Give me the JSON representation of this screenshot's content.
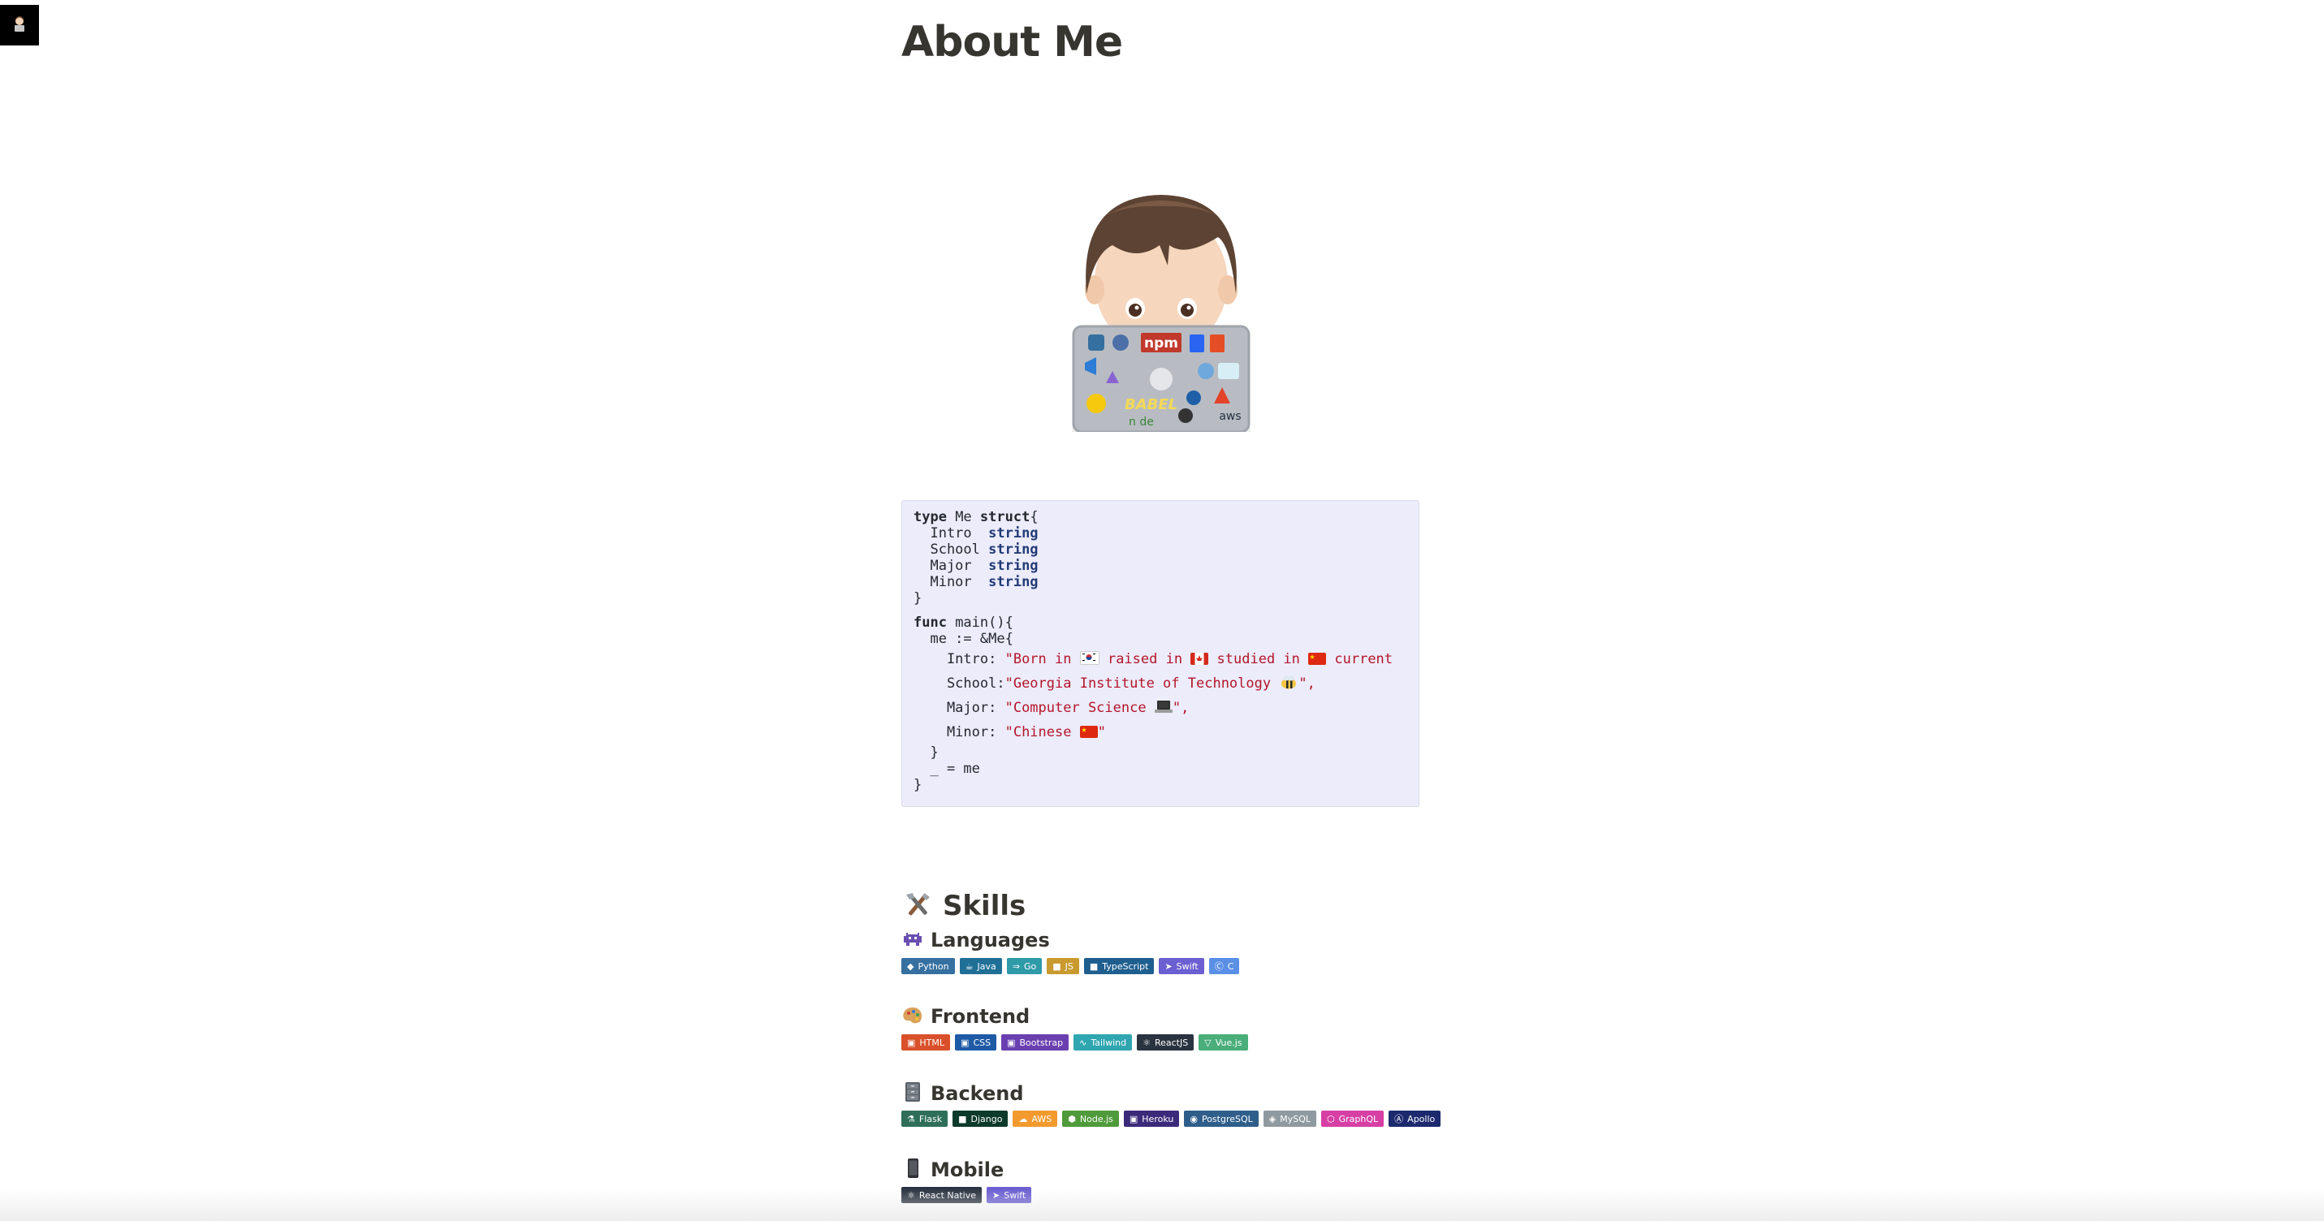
{
  "corner": {
    "icon": "avatar-icon"
  },
  "page": {
    "title": "About Me"
  },
  "avatar": {
    "icon": "memoji-laptop-icon"
  },
  "code": {
    "line1_kw1": "type",
    "line1_name": " Me ",
    "line1_kw2": "struct",
    "line1_end": "{",
    "fields": [
      {
        "name": "  Intro  ",
        "type": "string"
      },
      {
        "name": "  School ",
        "type": "string"
      },
      {
        "name": "  Major  ",
        "type": "string"
      },
      {
        "name": "  Minor  ",
        "type": "string"
      }
    ],
    "close1": "}",
    "func_kw": "func",
    "func_rest": " main(){",
    "me_line": "  me := &Me{",
    "intro_key": "    Intro: ",
    "intro_str_a": "\"Born in ",
    "intro_str_b": " raised in ",
    "intro_str_c": " studied in ",
    "intro_str_d": " current",
    "school_key": "    School:",
    "school_str": "\"Georgia Institute of Technology ",
    "school_end": "\",",
    "major_key": "    Major: ",
    "major_str": "\"Computer Science ",
    "major_end": "\",",
    "minor_key": "    Minor: ",
    "minor_str": "\"Chinese ",
    "minor_end": "\"",
    "close2": "  }",
    "assign": "  _ = me",
    "close3": "}",
    "flag_colors": {
      "korea": "#ffffff",
      "canada": "#d52b1e",
      "china": "#de2910"
    }
  },
  "skills": {
    "heading": "Skills",
    "heading_icon": "tools-icon",
    "sections": [
      {
        "title": "Languages",
        "icon": "alien-monster-icon",
        "badges": [
          {
            "label": "Python",
            "color": "#3670a0",
            "icon": "python-icon"
          },
          {
            "label": "Java",
            "color": "#1f6f97",
            "icon": "java-icon"
          },
          {
            "label": "Go",
            "color": "#2f9aa8",
            "icon": "go-icon"
          },
          {
            "label": "JS",
            "color": "#c99a2e",
            "icon": "javascript-icon"
          },
          {
            "label": "TypeScript",
            "color": "#1f5f8f",
            "icon": "typescript-icon"
          },
          {
            "label": "Swift",
            "color": "#6b5fd1",
            "icon": "swift-icon"
          },
          {
            "label": "C",
            "color": "#5a8fe6",
            "icon": "c-icon"
          }
        ]
      },
      {
        "title": "Frontend",
        "icon": "palette-icon",
        "badges": [
          {
            "label": "HTML",
            "color": "#d9502b",
            "icon": "html5-icon"
          },
          {
            "label": "CSS",
            "color": "#1f5aa6",
            "icon": "css3-icon"
          },
          {
            "label": "Bootstrap",
            "color": "#6a3fb0",
            "icon": "bootstrap-icon"
          },
          {
            "label": "Tailwind",
            "color": "#2fa6b0",
            "icon": "tailwind-icon"
          },
          {
            "label": "ReactJS",
            "color": "#2a3340",
            "icon": "react-icon"
          },
          {
            "label": "Vue.js",
            "color": "#4aae7a",
            "icon": "vue-icon"
          }
        ]
      },
      {
        "title": "Backend",
        "icon": "file-cabinet-icon",
        "badges": [
          {
            "label": "Flask",
            "color": "#2f6f5a",
            "icon": "flask-icon"
          },
          {
            "label": "Django",
            "color": "#0c3a2b",
            "icon": "django-icon"
          },
          {
            "label": "AWS",
            "color": "#f29a2e",
            "icon": "aws-icon"
          },
          {
            "label": "Node.js",
            "color": "#4f9a3a",
            "icon": "node-icon"
          },
          {
            "label": "Heroku",
            "color": "#3b2a7a",
            "icon": "heroku-icon"
          },
          {
            "label": "PostgreSQL",
            "color": "#2f5e8a",
            "icon": "postgresql-icon"
          },
          {
            "label": "MySQL",
            "color": "#8f9aa0",
            "icon": "mysql-icon"
          },
          {
            "label": "GraphQL",
            "color": "#d63fa4",
            "icon": "graphql-icon"
          },
          {
            "label": "Apollo",
            "color": "#1e2a6e",
            "icon": "apollo-icon"
          }
        ]
      },
      {
        "title": "Mobile",
        "icon": "mobile-phone-icon",
        "badges": [
          {
            "label": "React Native",
            "color": "#2a3340",
            "icon": "react-icon"
          },
          {
            "label": "Swift",
            "color": "#6b5fd1",
            "icon": "swift-icon"
          }
        ]
      }
    ]
  }
}
